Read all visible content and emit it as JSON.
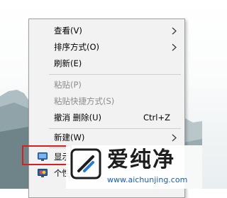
{
  "context_menu": {
    "items": [
      {
        "label": "查看(V)",
        "has_submenu": true,
        "disabled": false
      },
      {
        "label": "排序方式(O)",
        "has_submenu": true,
        "disabled": false
      },
      {
        "label": "刷新(E)",
        "has_submenu": false,
        "disabled": false
      },
      {
        "label": "粘贴(P)",
        "has_submenu": false,
        "disabled": true
      },
      {
        "label": "粘贴快捷方式(S)",
        "has_submenu": false,
        "disabled": true
      },
      {
        "label": "撤消 删除(U)",
        "shortcut": "Ctrl+Z",
        "has_submenu": false,
        "disabled": false
      },
      {
        "label": "新建(W)",
        "has_submenu": true,
        "disabled": false
      },
      {
        "label": "显示",
        "has_submenu": false,
        "disabled": false,
        "icon": "display-settings-icon"
      },
      {
        "label": "个性",
        "has_submenu": false,
        "disabled": false,
        "icon": "personalize-icon"
      }
    ]
  },
  "watermark": {
    "title": "爱纯净",
    "url": "www.aichunjing.com"
  },
  "colors": {
    "menu_background": "#f2f2f2",
    "highlight_border": "#d92020",
    "disabled_text": "#8d8d8d",
    "url_text": "#1a5fa8"
  }
}
